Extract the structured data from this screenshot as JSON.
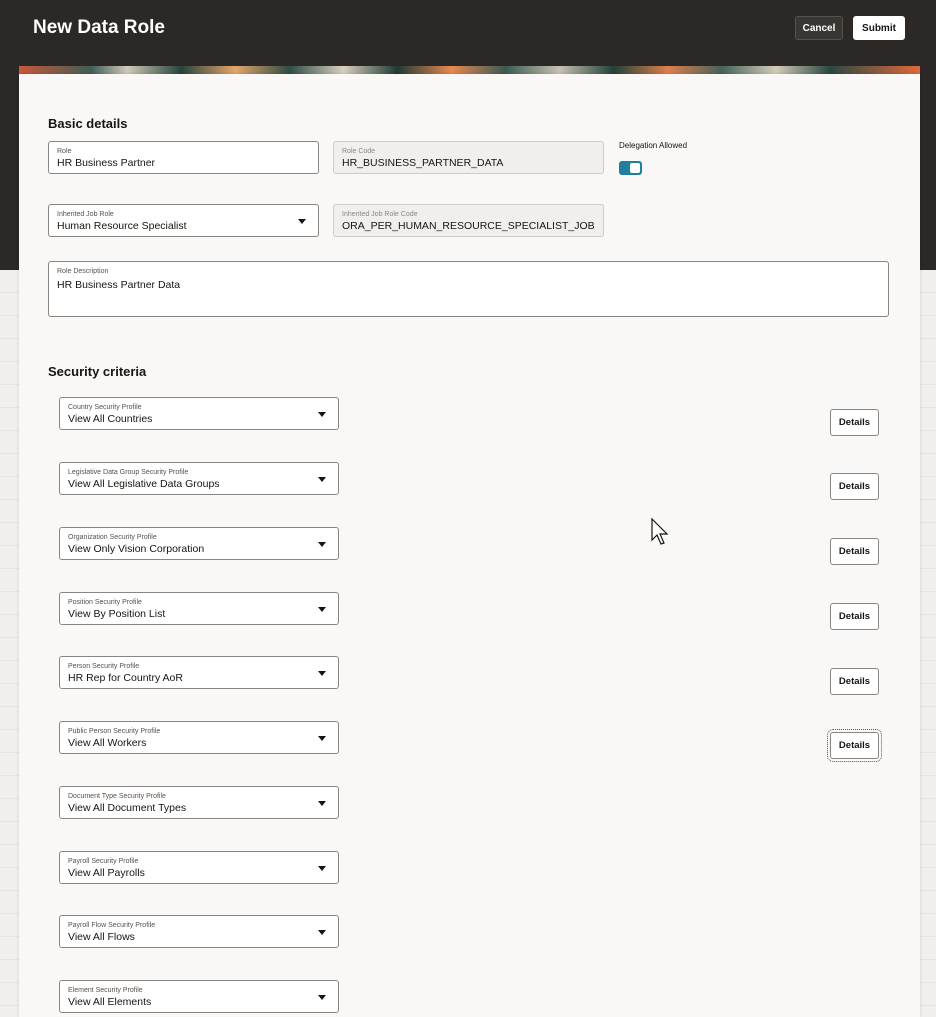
{
  "header": {
    "title": "New Data Role",
    "cancel_label": "Cancel",
    "submit_label": "Submit"
  },
  "basic_details": {
    "section_title": "Basic details",
    "role": {
      "label": "Role",
      "value": "HR Business Partner"
    },
    "role_code": {
      "label": "Role Code",
      "value": "HR_BUSINESS_PARTNER_DATA"
    },
    "delegation": {
      "label": "Delegation Allowed",
      "enabled": true
    },
    "inherited_job_role": {
      "label": "Inherited Job Role",
      "value": "Human Resource Specialist"
    },
    "inherited_job_role_code": {
      "label": "Inherited Job Role Code",
      "value": "ORA_PER_HUMAN_RESOURCE_SPECIALIST_JOB"
    },
    "role_description": {
      "label": "Role Description",
      "value": "HR Business Partner Data"
    }
  },
  "security_criteria": {
    "section_title": "Security criteria",
    "details_label": "Details",
    "profiles": [
      {
        "label": "Country Security Profile",
        "value": "View All Countries",
        "has_details": true
      },
      {
        "label": "Legislative Data Group Security Profile",
        "value": "View All Legislative Data Groups",
        "has_details": true
      },
      {
        "label": "Organization Security Profile",
        "value": "View Only Vision Corporation",
        "has_details": true
      },
      {
        "label": "Position Security Profile",
        "value": "View By Position List",
        "has_details": true
      },
      {
        "label": "Person Security Profile",
        "value": "HR Rep for Country AoR",
        "has_details": true
      },
      {
        "label": "Public Person Security Profile",
        "value": "View All Workers",
        "has_details": true
      },
      {
        "label": "Document Type Security Profile",
        "value": "View All Document Types",
        "has_details": false
      },
      {
        "label": "Payroll Security Profile",
        "value": "View All Payrolls",
        "has_details": false
      },
      {
        "label": "Payroll Flow Security Profile",
        "value": "View All Flows",
        "has_details": false
      },
      {
        "label": "Element Security Profile",
        "value": "View All Elements",
        "has_details": false
      }
    ]
  },
  "colors": {
    "header_bg": "#2b2826",
    "toggle_on": "#227e9e",
    "card_bg": "#f9f8f6"
  }
}
